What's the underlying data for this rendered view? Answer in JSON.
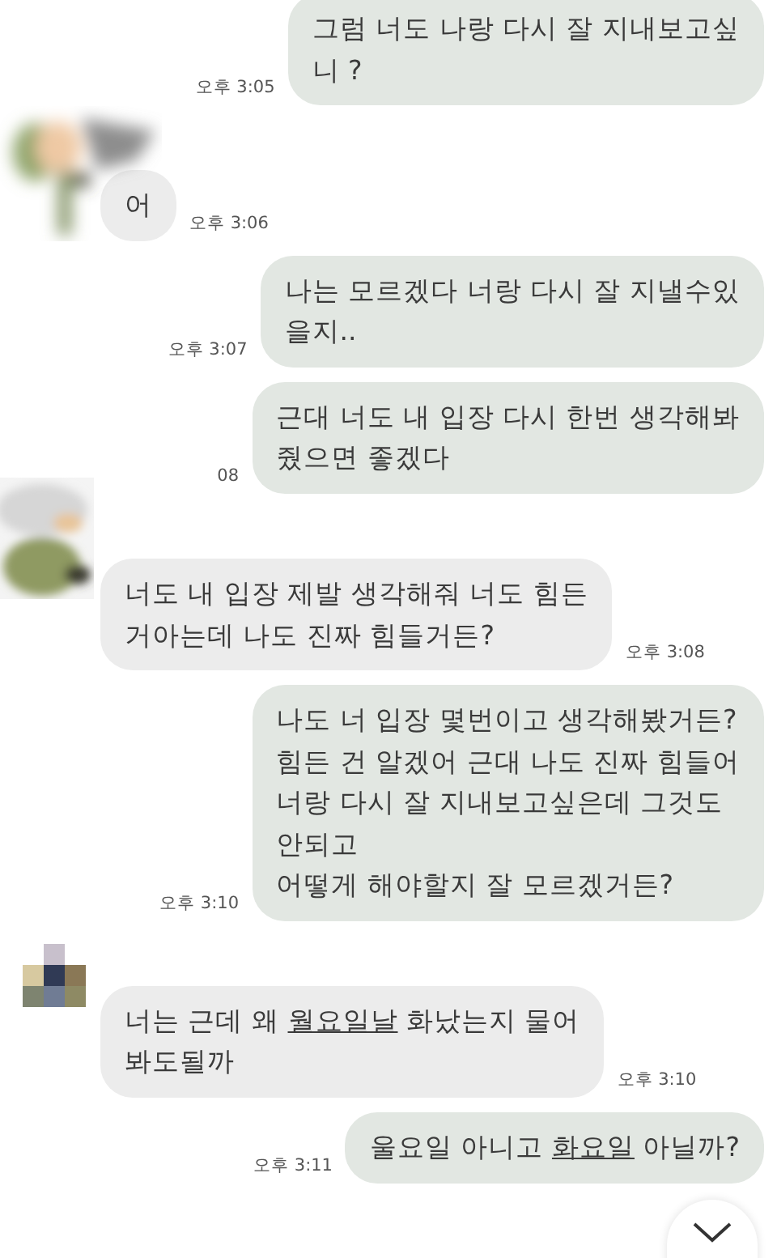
{
  "messages": [
    {
      "kind": "sent",
      "text": "그럼 너도 나랑 다시 잘 지내보고싶\n니 ?",
      "time": "오후 3:05"
    },
    {
      "kind": "received",
      "avatar": true,
      "text": "어",
      "time": "오후 3:06"
    },
    {
      "kind": "sent",
      "text": "나는 모르겠다 너랑 다시 잘 지낼수있\n을지..",
      "time": "오후 3:07"
    },
    {
      "kind": "sent",
      "text": "근대 너도 내 입장 다시 한번 생각해봐\n줬으면 좋겠다",
      "time": "08"
    },
    {
      "kind": "received",
      "avatar": true,
      "text": "너도 내 입장 제발 생각해줘 너도 힘든\n거아는데 나도 진짜 힘들거든?",
      "time": "오후 3:08"
    },
    {
      "kind": "sent",
      "text": "나도 너 입장 몇번이고 생각해봤거든?\n힘든 건 알겠어 근대 나도 진짜 힘들어\n너랑 다시 잘 지내보고싶은데 그것도\n안되고\n어떻게 해야할지 잘 모르겠거든?",
      "time": "오후 3:10"
    },
    {
      "kind": "received",
      "avatar": true,
      "parts": [
        {
          "text": "너는 근데 왜 ",
          "underline": false
        },
        {
          "text": "월요일날",
          "underline": true
        },
        {
          "text": " 화났는지 물어\n봐도될까",
          "underline": false
        }
      ],
      "time": "오후 3:10"
    },
    {
      "kind": "sent",
      "parts": [
        {
          "text": "울요일 아니고 ",
          "underline": false
        },
        {
          "text": "화요일",
          "underline": true
        },
        {
          "text": " 아닐까?",
          "underline": false
        }
      ],
      "time": "오후 3:11"
    }
  ]
}
